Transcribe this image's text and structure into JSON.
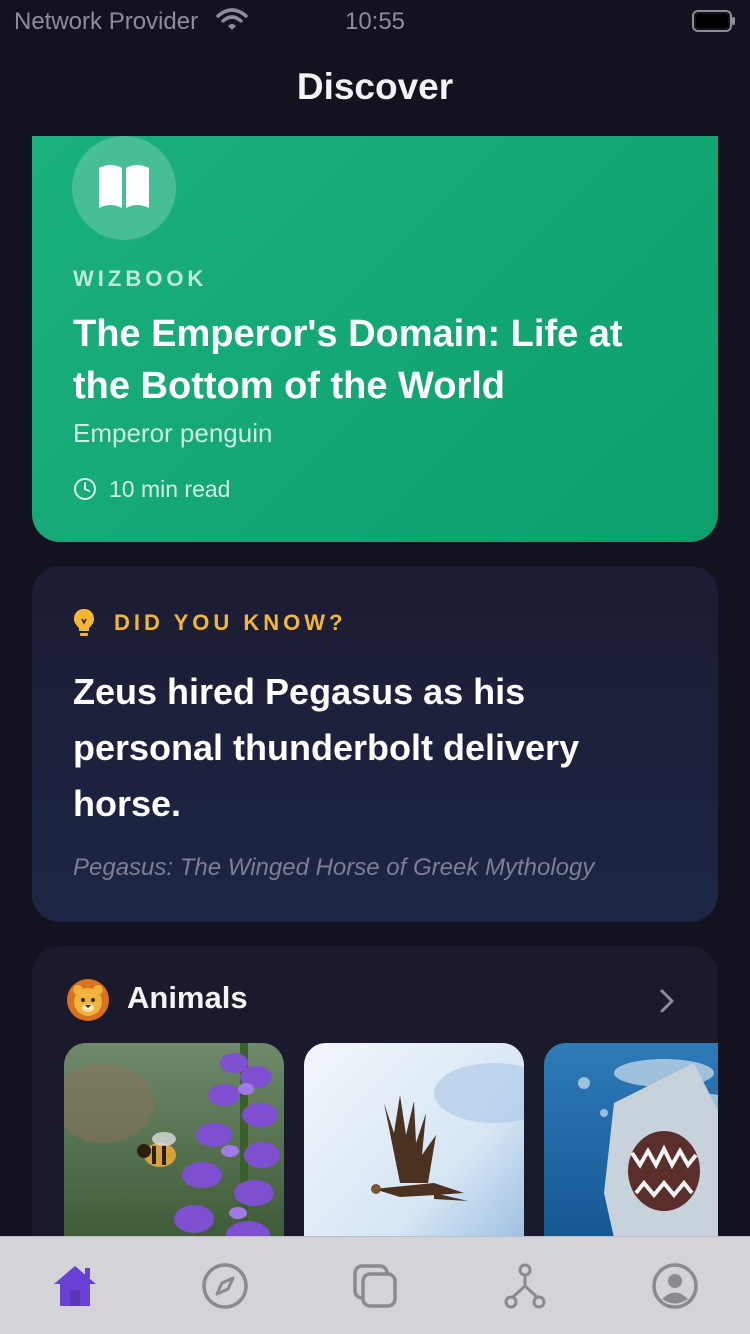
{
  "status_bar": {
    "carrier": "Network Provider",
    "time": "10:55"
  },
  "nav": {
    "title": "Discover"
  },
  "feature_card": {
    "kicker": "WIZBOOK",
    "title": "The Emperor's Domain: Life at the Bottom of the World",
    "subtitle": "Emperor penguin",
    "read_time": "10 min read",
    "icon": "book-icon",
    "color": "#12a874"
  },
  "fact_card": {
    "kicker": "DID YOU KNOW?",
    "text": "Zeus hired Pegasus as his personal thunderbolt delivery horse.",
    "source": "Pegasus: The Winged Horse of Greek Mythology",
    "icon": "lightbulb-icon",
    "accent_color": "#f5b731"
  },
  "category": {
    "title": "Animals",
    "icon": "lion-face-icon",
    "thumbnails": [
      {
        "subject": "bee-on-lupine-image"
      },
      {
        "subject": "eagle-in-flight-image"
      },
      {
        "subject": "shark-underwater-image"
      }
    ]
  },
  "tab_bar": {
    "active_color": "#6a3fd6",
    "inactive_color": "#8a8a90",
    "tabs": [
      {
        "icon": "home-icon",
        "active": true
      },
      {
        "icon": "compass-icon",
        "active": false
      },
      {
        "icon": "cards-icon",
        "active": false
      },
      {
        "icon": "branch-icon",
        "active": false
      },
      {
        "icon": "profile-icon",
        "active": false
      }
    ]
  }
}
